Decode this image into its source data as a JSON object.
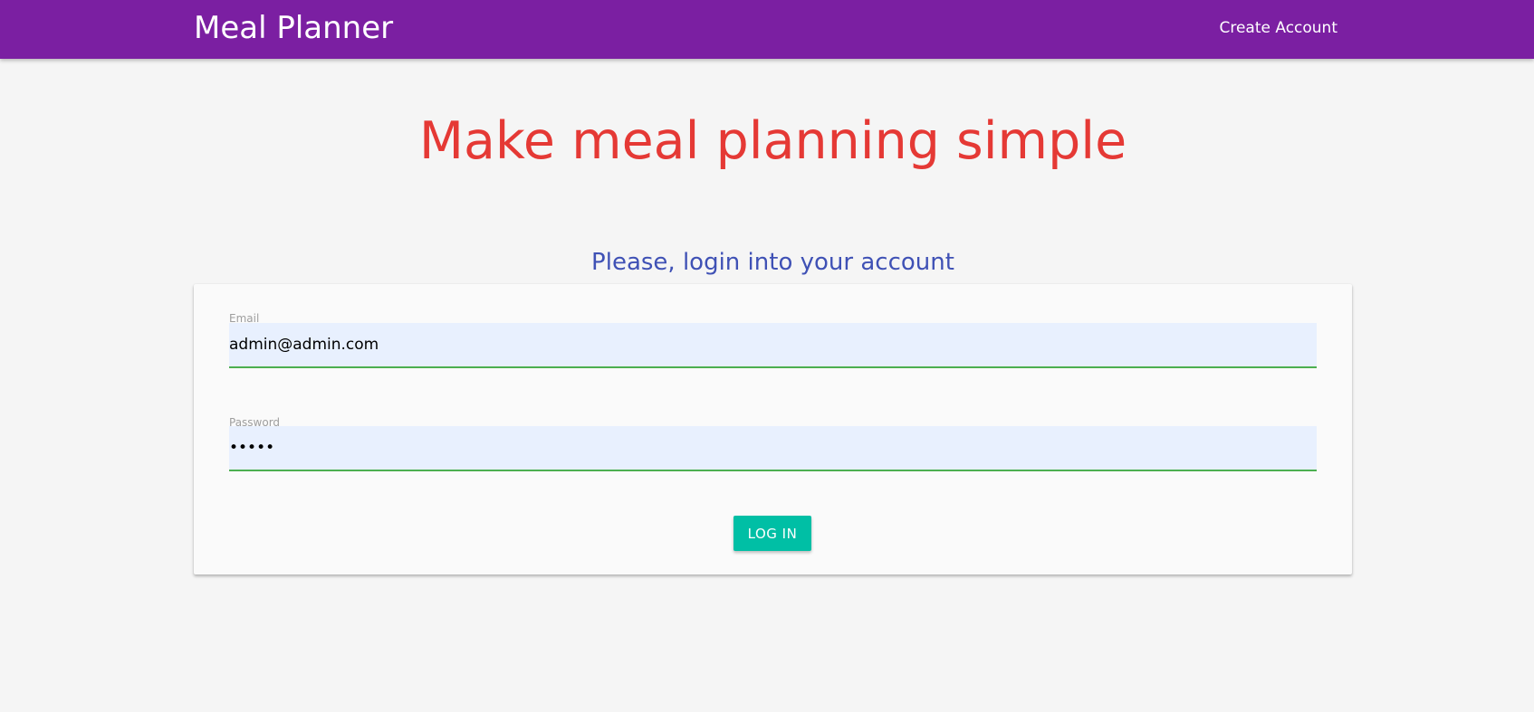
{
  "navbar": {
    "brand": "Meal Planner",
    "create_account": "Create Account",
    "background_color": "#7b1fa2"
  },
  "hero": {
    "title": "Make meal planning simple",
    "title_color": "#e53935"
  },
  "login": {
    "subtitle": "Please, login into your account",
    "subtitle_color": "#3f51b5",
    "email": {
      "label": "Email",
      "value": "admin@admin.com"
    },
    "password": {
      "label": "Password",
      "value": "admin"
    },
    "button_label": "LOG IN",
    "button_color": "#00bfa5",
    "field_underline_color": "#4caf50"
  }
}
